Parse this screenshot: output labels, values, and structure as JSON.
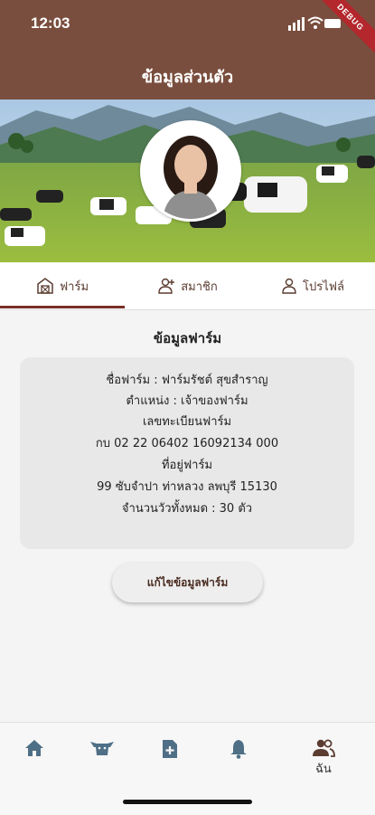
{
  "status": {
    "time": "12:03",
    "debug_banner": "DEBUG"
  },
  "appbar": {
    "title": "ข้อมูลส่วนตัว"
  },
  "tabs": [
    {
      "label": "ฟาร์ม",
      "icon": "barn-icon",
      "active": true
    },
    {
      "label": "สมาชิก",
      "icon": "add-person-icon",
      "active": false
    },
    {
      "label": "โปรไฟล์",
      "icon": "person-icon",
      "active": false
    }
  ],
  "farm": {
    "section_title": "ข้อมูลฟาร์ม",
    "lines": [
      "ชื่อฟาร์ม : ฟาร์มรัชต์ สุขสำราญ",
      "ตำแหน่ง : เจ้าของฟาร์ม",
      "เลขทะเบียนฟาร์ม",
      "กบ 02 22 06402 16092134 000",
      "ที่อยู่ฟาร์ม",
      "99 ซับจำปา ท่าหลวง ลพบุรี 15130",
      "จำนวนวัวทั้งหมด : 30 ตัว"
    ],
    "edit_button": "แก้ไขข้อมูลฟาร์ม"
  },
  "bottom_nav": {
    "items": [
      "home-icon",
      "cow-icon",
      "add-document-icon",
      "bell-icon",
      "group-icon"
    ],
    "active_label": "ฉัน"
  },
  "colors": {
    "brand": "#7a4e3e",
    "icon": "#4f6f86",
    "accent": "#7a2e2a"
  }
}
